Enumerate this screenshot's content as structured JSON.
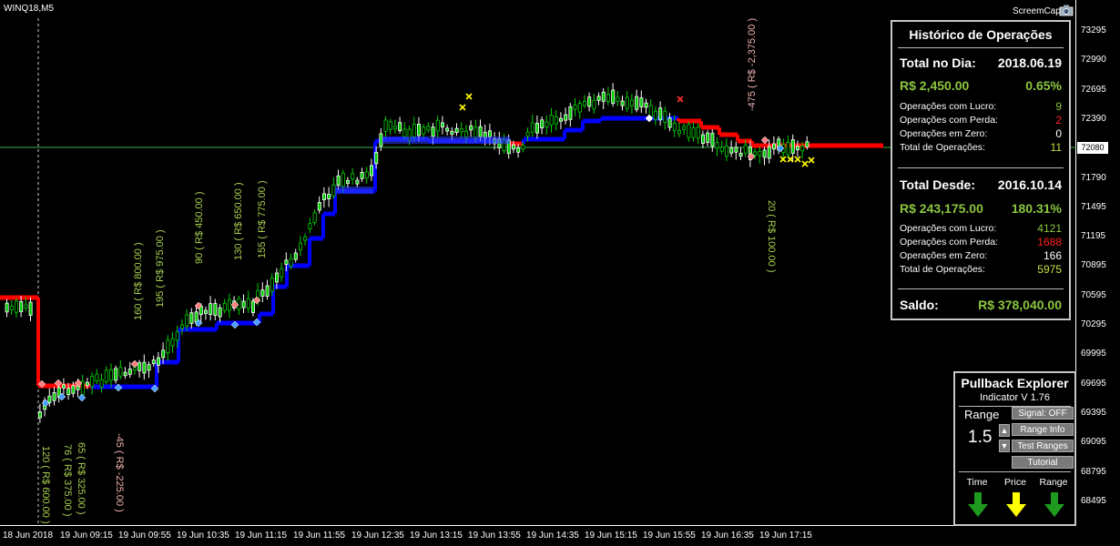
{
  "window": {
    "symbol": "WINQ18,M5",
    "screencap_label": "ScreemCap",
    "current_price": "72080"
  },
  "y_axis": [
    "73295",
    "72990",
    "72695",
    "72390",
    "72080",
    "71790",
    "71495",
    "71195",
    "70895",
    "70595",
    "70295",
    "69995",
    "69695",
    "69395",
    "69095",
    "68795",
    "68495"
  ],
  "x_axis": [
    "18 Jun 2018",
    "19 Jun 09:15",
    "19 Jun 09:55",
    "19 Jun 10:35",
    "19 Jun 11:15",
    "19 Jun 11:55",
    "19 Jun 12:35",
    "19 Jun 13:15",
    "19 Jun 13:55",
    "19 Jun 14:35",
    "19 Jun 15:15",
    "19 Jun 15:55",
    "19 Jun 16:35",
    "19 Jun 17:15"
  ],
  "trade_labels": [
    "120 ( R$ 600.00 )",
    "76 ( R$ 375.00 )",
    "65 ( R$ 325.00 )",
    "-45 ( R$ -225.00 )",
    "160 ( R$ 800.00 )",
    "195 ( R$ 975.00 )",
    "90 ( R$ 450.00 )",
    "130 ( R$ 650.00 )",
    "155 ( R$ 775.00 )",
    "-475 ( R$ -2,375.00 )",
    "20 ( R$ 100.00 )"
  ],
  "history": {
    "title": "Histórico de Operações",
    "day_label": "Total no Dia:",
    "day_date": "2018.06.19",
    "day_amount": "R$ 2,450.00",
    "day_pct": "0.65%",
    "day_rows": [
      {
        "label": "Operações com Lucro:",
        "value": "9",
        "color": "#8cc63f"
      },
      {
        "label": "Operações com Perda:",
        "value": "2",
        "color": "#ff2020"
      },
      {
        "label": "Operações em Zero:",
        "value": "0",
        "color": "#ffffff"
      },
      {
        "label": "Total de Operações:",
        "value": "11",
        "color": "#c8e040"
      }
    ],
    "since_label": "Total Desde:",
    "since_date": "2016.10.14",
    "since_amount": "R$ 243,175.00",
    "since_pct": "180.31%",
    "since_rows": [
      {
        "label": "Operações com Lucro:",
        "value": "4121",
        "color": "#8cc63f"
      },
      {
        "label": "Operações com Perda:",
        "value": "1688",
        "color": "#ff2020"
      },
      {
        "label": "Operações em Zero:",
        "value": "166",
        "color": "#ffffff"
      },
      {
        "label": "Total de Operações:",
        "value": "5975",
        "color": "#c8e040"
      }
    ],
    "saldo_label": "Saldo:",
    "saldo_value": "R$ 378,040.00"
  },
  "pullback": {
    "title": "Pullback Explorer",
    "subtitle": "Indicator V 1.76",
    "range_label": "Range",
    "range_value": "1.5",
    "signal_btn": "Signal: OFF",
    "range_info_btn": "Range Info",
    "test_ranges_btn": "Test Ranges",
    "tutorial_btn": "Tutorial",
    "time_label": "Time",
    "price_label": "Price",
    "range_col_label": "Range",
    "time_color": "#1e9a1e",
    "price_color": "#ffff00",
    "range_color": "#1e9a1e"
  },
  "colors": {
    "bull": "#00d000",
    "bear": "#ffffff",
    "up_trend": "#0000ff",
    "down_trend": "#ff0000",
    "label_green": "#a8d050",
    "label_pink": "#f0b0b0"
  }
}
